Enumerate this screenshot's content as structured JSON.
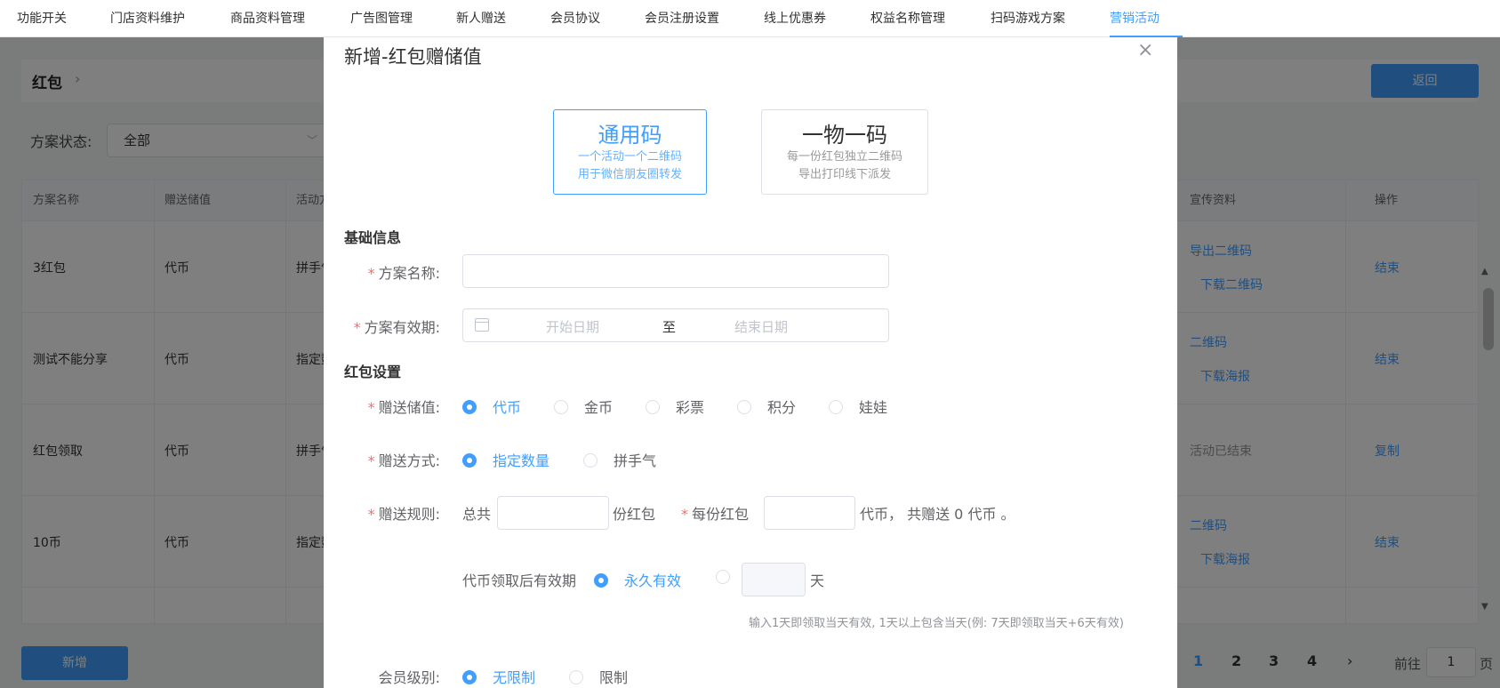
{
  "topnav": {
    "items": [
      "功能开关",
      "门店资料维护",
      "商品资料管理",
      "广告图管理",
      "新人赠送",
      "会员协议",
      "会员注册设置",
      "线上优惠券",
      "权益名称管理",
      "扫码游戏方案",
      "营销活动"
    ],
    "active": "营销活动"
  },
  "page": {
    "breadcrumb_title": "红包",
    "back_label": "返回",
    "filter_label": "方案状态:",
    "filter_value": "全部",
    "table": {
      "headers": [
        "方案名称",
        "赠送储值",
        "活动方",
        "宣传资料",
        "操作"
      ],
      "rows": [
        {
          "name": "3红包",
          "value": "代币",
          "mode": "拼手气",
          "promo1": "导出二维码",
          "promo2": "下载二维码",
          "action": "结束"
        },
        {
          "name": "测试不能分享",
          "value": "代币",
          "mode": "指定数",
          "promo1": "二维码",
          "promo2": "下载海报",
          "action": "结束"
        },
        {
          "name": "红包领取",
          "value": "代币",
          "mode": "拼手气",
          "promo1": "活动已结束",
          "promo2": "",
          "action": "复制"
        },
        {
          "name": "10币",
          "value": "代币",
          "mode": "指定数",
          "promo1": "二维码",
          "promo2": "下载海报",
          "action": "结束"
        }
      ]
    },
    "add_label": "新增",
    "pagination": {
      "pages": [
        "1",
        "2",
        "3",
        "4"
      ],
      "current": "1",
      "next": "›",
      "goto_label": "前往",
      "goto_value": "1",
      "goto_unit": "页"
    }
  },
  "dialog": {
    "title": "新增-红包赠储值",
    "close": "×",
    "code_types": [
      {
        "title": "通用码",
        "desc1": "一个活动一个二维码",
        "desc2": "用于微信朋友圈转发",
        "selected": true
      },
      {
        "title": "一物一码",
        "desc1": "每一份红包独立二维码",
        "desc2": "导出打印线下派发",
        "selected": false
      }
    ],
    "basic_section": "基础信息",
    "plan_name_label": "方案名称:",
    "plan_name_value": "",
    "validity_label": "方案有效期:",
    "date_start_placeholder": "开始日期",
    "date_sep": "至",
    "date_end_placeholder": "结束日期",
    "redpack_section": "红包设置",
    "gift_value_label": "赠送储值:",
    "gift_value_options": [
      "代币",
      "金币",
      "彩票",
      "积分",
      "娃娃"
    ],
    "gift_value_selected": "代币",
    "gift_mode_label": "赠送方式:",
    "gift_mode_options": [
      "指定数量",
      "拼手气"
    ],
    "gift_mode_selected": "指定数量",
    "gift_rule_label": "赠送规则:",
    "rule_total_prefix": "总共",
    "rule_total_suffix": "份红包",
    "rule_each_label": "每份红包",
    "rule_each_suffix": "代币，  共赠送 0 代币 。",
    "expiry_label": "代币领取后有效期",
    "expiry_options": [
      "永久有效",
      ""
    ],
    "expiry_selected": "永久有效",
    "expiry_unit": "天",
    "expiry_hint": "输入1天即领取当天有效, 1天以上包含当天(例: 7天即领取当天+6天有效)",
    "member_level_label": "会员级别:",
    "member_level_options": [
      "无限制",
      "限制"
    ],
    "member_level_selected": "无限制"
  },
  "colors": {
    "accent": "#409eff",
    "required": "#f56c6c",
    "overlay": "rgba(0,0,0,0.5)"
  }
}
